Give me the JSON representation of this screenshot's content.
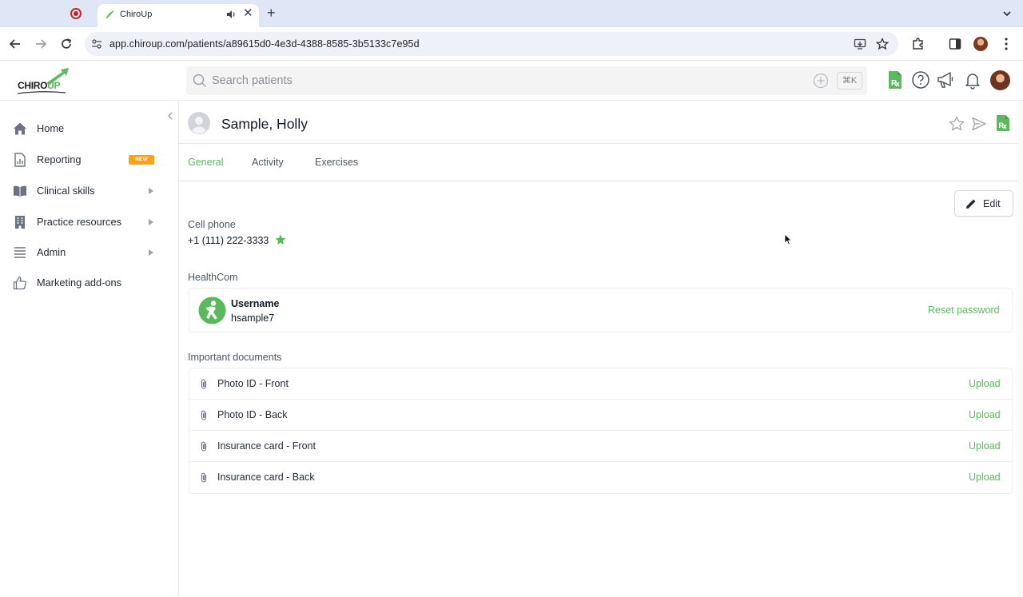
{
  "browser": {
    "tab_title": "ChiroUp",
    "tab_close": "✕",
    "tab_new": "+",
    "url": "app.chiroup.com/patients/a89615d0-4e3d-4388-8585-3b5133c7e95d"
  },
  "header": {
    "logo_chiro": "CHIRO",
    "logo_up": "UP",
    "search_placeholder": "Search patients",
    "shortcut": "⌘K"
  },
  "sidebar": {
    "items": [
      {
        "label": "Home",
        "icon": "home-icon"
      },
      {
        "label": "Reporting",
        "icon": "report-icon",
        "badge": "NEW"
      },
      {
        "label": "Clinical skills",
        "icon": "book-icon",
        "has_submenu": true
      },
      {
        "label": "Practice resources",
        "icon": "building-icon",
        "has_submenu": true
      },
      {
        "label": "Admin",
        "icon": "list-icon",
        "has_submenu": true
      },
      {
        "label": "Marketing add-ons",
        "icon": "thumbs-up-icon"
      }
    ]
  },
  "patient": {
    "name": "Sample, Holly"
  },
  "tabs": [
    {
      "label": "General",
      "active": true
    },
    {
      "label": "Activity",
      "active": false
    },
    {
      "label": "Exercises",
      "active": false
    }
  ],
  "general": {
    "edit_label": "Edit",
    "cell_phone_label": "Cell phone",
    "cell_phone_value": "+1 (111) 222-3333",
    "healthcom_label": "HealthCom",
    "username_label": "Username",
    "username_value": "hsample7",
    "reset_password": "Reset password",
    "documents_label": "Important documents",
    "documents": [
      {
        "name": "Photo ID - Front",
        "action": "Upload"
      },
      {
        "name": "Photo ID - Back",
        "action": "Upload"
      },
      {
        "name": "Insurance card - Front",
        "action": "Upload"
      },
      {
        "name": "Insurance card - Back",
        "action": "Upload"
      }
    ]
  },
  "colors": {
    "accent": "#5cb85c",
    "badge": "#f5a31a",
    "record": "#c0262d"
  }
}
